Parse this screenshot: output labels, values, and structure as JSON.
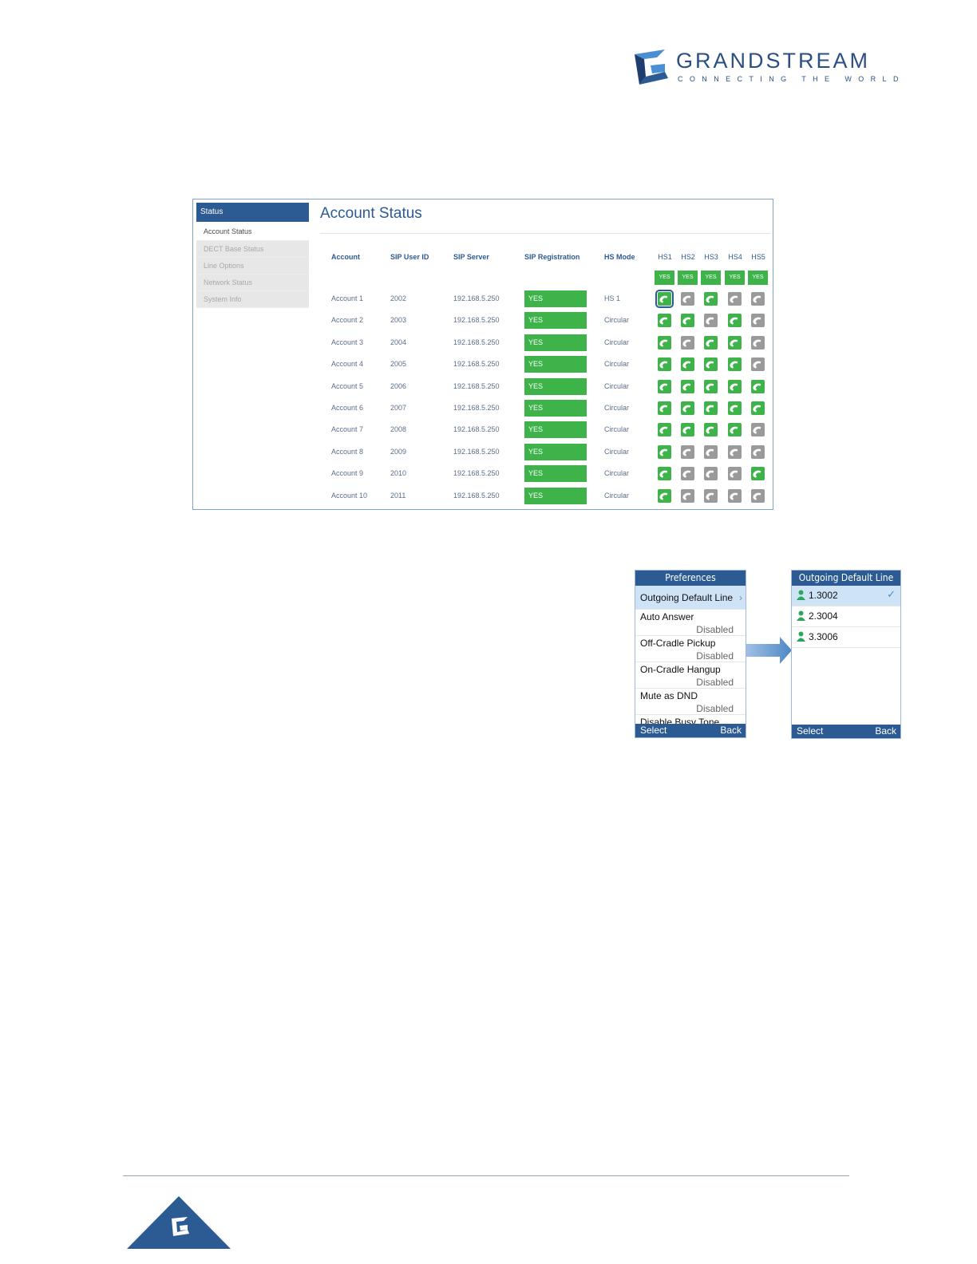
{
  "logo": {
    "name": "GRANDSTREAM",
    "tagline": "CONNECTING THE WORLD",
    "color": "#2b4f83"
  },
  "web_ui": {
    "sidebar": {
      "header": "Status",
      "items": [
        {
          "label": "Account Status",
          "active": true
        },
        {
          "label": "DECT Base Status",
          "active": false
        },
        {
          "label": "Line Options",
          "active": false
        },
        {
          "label": "Network Status",
          "active": false
        },
        {
          "label": "System Info",
          "active": false
        }
      ]
    },
    "title": "Account Status",
    "columns": {
      "account": "Account",
      "sip_user_id": "SIP User ID",
      "sip_server": "SIP Server",
      "sip_registration": "SIP Registration",
      "hs_mode": "HS Mode"
    },
    "handset_columns": [
      "HS1",
      "HS2",
      "HS3",
      "HS4",
      "HS5"
    ],
    "handset_status": [
      "YES",
      "YES",
      "YES",
      "YES",
      "YES"
    ],
    "rows": [
      {
        "account": "Account 1",
        "user_id": "2002",
        "server": "192.168.5.250",
        "registration": "YES",
        "mode": "HS 1",
        "hs": [
          1,
          0,
          1,
          0,
          0
        ]
      },
      {
        "account": "Account 2",
        "user_id": "2003",
        "server": "192.168.5.250",
        "registration": "YES",
        "mode": "Circular",
        "hs": [
          1,
          1,
          0,
          1,
          0
        ]
      },
      {
        "account": "Account 3",
        "user_id": "2004",
        "server": "192.168.5.250",
        "registration": "YES",
        "mode": "Circular",
        "hs": [
          1,
          0,
          1,
          1,
          0
        ]
      },
      {
        "account": "Account 4",
        "user_id": "2005",
        "server": "192.168.5.250",
        "registration": "YES",
        "mode": "Circular",
        "hs": [
          1,
          1,
          1,
          1,
          0
        ]
      },
      {
        "account": "Account 5",
        "user_id": "2006",
        "server": "192.168.5.250",
        "registration": "YES",
        "mode": "Circular",
        "hs": [
          1,
          1,
          1,
          1,
          1
        ]
      },
      {
        "account": "Account 6",
        "user_id": "2007",
        "server": "192.168.5.250",
        "registration": "YES",
        "mode": "Circular",
        "hs": [
          1,
          1,
          1,
          1,
          1
        ]
      },
      {
        "account": "Account 7",
        "user_id": "2008",
        "server": "192.168.5.250",
        "registration": "YES",
        "mode": "Circular",
        "hs": [
          1,
          1,
          1,
          1,
          0
        ]
      },
      {
        "account": "Account 8",
        "user_id": "2009",
        "server": "192.168.5.250",
        "registration": "YES",
        "mode": "Circular",
        "hs": [
          1,
          0,
          0,
          0,
          0
        ]
      },
      {
        "account": "Account 9",
        "user_id": "2010",
        "server": "192.168.5.250",
        "registration": "YES",
        "mode": "Circular",
        "hs": [
          1,
          0,
          0,
          0,
          1
        ]
      },
      {
        "account": "Account 10",
        "user_id": "2011",
        "server": "192.168.5.250",
        "registration": "YES",
        "mode": "Circular",
        "hs": [
          1,
          0,
          0,
          0,
          0
        ]
      }
    ],
    "colors": {
      "active": "#3db34a",
      "inactive": "#9a9a9a",
      "accent": "#2c5a93"
    }
  },
  "handset_preferences": {
    "title": "Preferences",
    "items": [
      {
        "label": "Outgoing Default Line",
        "value": "",
        "selected": true
      },
      {
        "label": "Auto Answer",
        "value": "Disabled"
      },
      {
        "label": "Off-Cradle Pickup",
        "value": "Disabled"
      },
      {
        "label": "On-Cradle Hangup",
        "value": "Disabled"
      },
      {
        "label": "Mute as DND",
        "value": "Disabled"
      },
      {
        "label": "Disable Busy Tone",
        "value": ""
      }
    ],
    "softkeys": {
      "left": "Select",
      "right": "Back"
    }
  },
  "handset_lines": {
    "title": "Outgoing Default Line",
    "items": [
      {
        "label": "1.3002",
        "checked": true
      },
      {
        "label": "2.3004",
        "checked": false
      },
      {
        "label": "3.3006",
        "checked": false
      }
    ],
    "softkeys": {
      "left": "Select",
      "right": "Back"
    }
  }
}
